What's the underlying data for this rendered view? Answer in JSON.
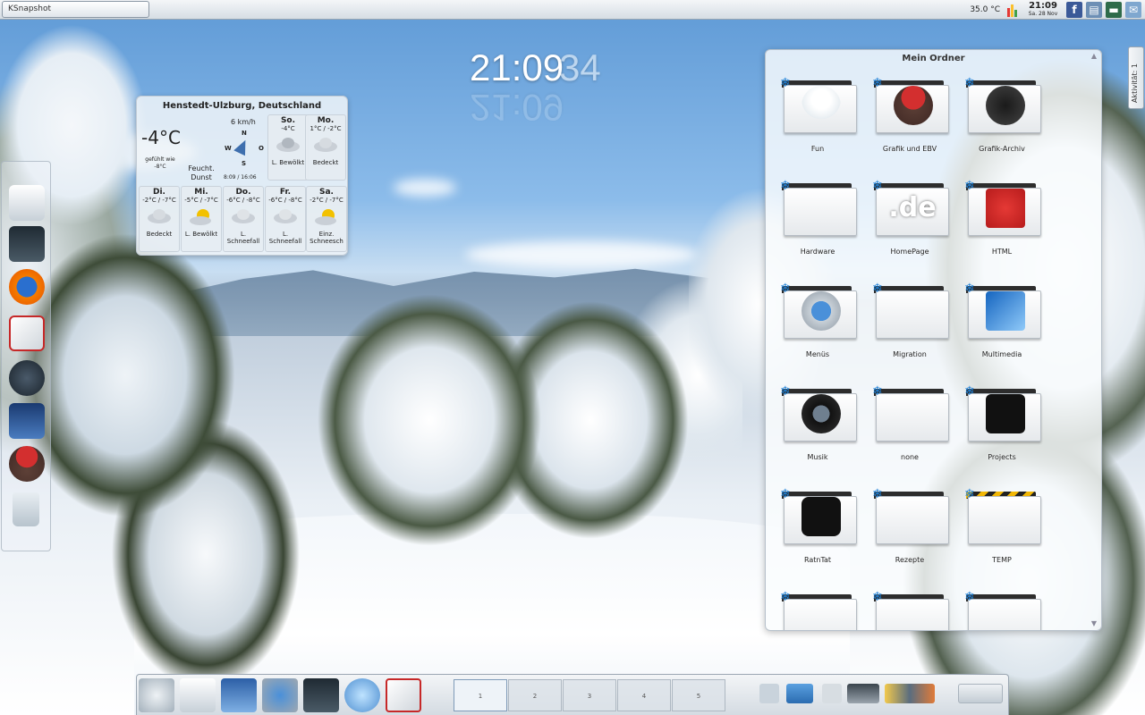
{
  "taskbar": {
    "window_title": "KSnapshot"
  },
  "tray": {
    "temperature": "35.0 °C",
    "time": "21:09",
    "date": "Sa. 28 Nov",
    "icons": [
      "cpu-bars-icon",
      "facebook-icon",
      "network-icon",
      "wallet-icon",
      "mail-icon"
    ]
  },
  "desktop_clock": {
    "hours_minutes": "21:09",
    "seconds": "34"
  },
  "weather": {
    "location": "Henstedt-Ulzburg, Deutschland",
    "current_temp": "-4°C",
    "feels_like": "gefühlt wie -8°C",
    "condition": "Feucht. Dunst",
    "wind_speed": "6 km/h",
    "compass": {
      "n": "N",
      "s": "S",
      "w": "W",
      "o": "O"
    },
    "sun_times": "8:09 / 16:06",
    "forecast": [
      {
        "day": "So.",
        "range": "-4°C",
        "desc": "L. Bewölkt",
        "icon": "cloud-icon"
      },
      {
        "day": "Mo.",
        "range": "1°C / -2°C",
        "desc": "Bedeckt",
        "icon": "cloud-icon"
      },
      {
        "day": "Di.",
        "range": "-2°C / -7°C",
        "desc": "Bedeckt",
        "icon": "cloud-icon"
      },
      {
        "day": "Mi.",
        "range": "-5°C / -7°C",
        "desc": "L. Bewölkt",
        "icon": "sun-cloud-icon"
      },
      {
        "day": "Do.",
        "range": "-6°C / -8°C",
        "desc": "L. Schneefall",
        "icon": "snow-cloud-icon"
      },
      {
        "day": "Fr.",
        "range": "-6°C / -8°C",
        "desc": "L. Schneefall",
        "icon": "snow-cloud-icon"
      },
      {
        "day": "Sa.",
        "range": "-2°C / -7°C",
        "desc": "Einz. Schneesch",
        "icon": "sun-cloud-icon"
      }
    ]
  },
  "folder_view": {
    "title": "Mein Ordner",
    "items": [
      {
        "label": "Fun",
        "icon": "snowman-icon"
      },
      {
        "label": "Grafik und EBV",
        "icon": "gimp-icon"
      },
      {
        "label": "Grafik-Archiv",
        "icon": "inkscape-icon"
      },
      {
        "label": "Hardware",
        "icon": "folder-icon"
      },
      {
        "label": "HomePage",
        "icon": "de-domain-icon"
      },
      {
        "label": "HTML",
        "icon": "gift-ribbon-icon"
      },
      {
        "label": "Menüs",
        "icon": "gear-play-icon"
      },
      {
        "label": "Migration",
        "icon": "folder-icon"
      },
      {
        "label": "Multimedia",
        "icon": "film-microphone-icon"
      },
      {
        "label": "Musik",
        "icon": "music-player-icon"
      },
      {
        "label": "none",
        "icon": "folder-icon"
      },
      {
        "label": "Projects",
        "icon": "puzzle-icon"
      },
      {
        "label": "RatnTat",
        "icon": "speech-bubble-icon"
      },
      {
        "label": "Rezepte",
        "icon": "folder-icon"
      },
      {
        "label": "TEMP",
        "icon": "caution-stripe-icon"
      }
    ]
  },
  "side_tab": {
    "label": "Aktivität: 1"
  },
  "pager": {
    "desktops": [
      "1",
      "2",
      "3",
      "4",
      "5"
    ],
    "active": "1"
  }
}
